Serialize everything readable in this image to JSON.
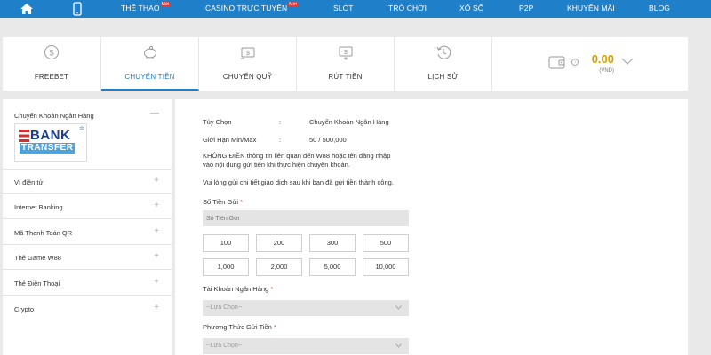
{
  "topnav": {
    "items": [
      {
        "label": "THỂ THAO",
        "hot": "Mới"
      },
      {
        "label": "CASINO TRỰC TUYẾN",
        "hot": "Mới"
      },
      {
        "label": "SLOT"
      },
      {
        "label": "TRÒ CHƠI"
      },
      {
        "label": "XỔ SỐ"
      },
      {
        "label": "P2P"
      },
      {
        "label": "KHUYẾN MÃI"
      },
      {
        "label": "BLOG"
      }
    ]
  },
  "tabs": [
    {
      "label": "FREEBET",
      "icon": "dollar-coin-icon"
    },
    {
      "label": "CHUYỂN TIỀN",
      "icon": "piggy-bank-icon",
      "active": true
    },
    {
      "label": "CHUYỂN QUỸ",
      "icon": "transfer-icon"
    },
    {
      "label": "RÚT TIỀN",
      "icon": "withdraw-icon"
    },
    {
      "label": "LỊCH SỬ",
      "icon": "history-icon"
    }
  ],
  "wallet": {
    "amount": "0.00",
    "currency": "(VND)",
    "info": "i"
  },
  "sidebar": {
    "bank_transfer": {
      "label": "Chuyển Khoản Ngân Hàng",
      "sign": "—",
      "logo_text_1": "BANK",
      "logo_text_2": "TRANSFER"
    },
    "items": [
      {
        "label": "Ví điện tử",
        "sign": "+"
      },
      {
        "label": "Internet Banking",
        "sign": "+"
      },
      {
        "label": "Mã Thanh Toán QR",
        "sign": "+"
      },
      {
        "label": "Thẻ Game W88",
        "sign": "+"
      },
      {
        "label": "Thẻ Điện Thoại",
        "sign": "+"
      },
      {
        "label": "Crypto",
        "sign": "+"
      }
    ]
  },
  "main": {
    "option_label": "Tùy Chọn",
    "option_sep": ":",
    "option_value": "Chuyển Khoản Ngân Hàng",
    "limit_label": "Giới Hạn Min/Max",
    "limit_sep": ":",
    "limit_value": "50 / 500,000",
    "notice_1": "KHÔNG ĐIỀN thông tin liên quan đến W88 hoặc tên đăng nhập",
    "notice_2": "vào nội dung gửi tiền khi thực hiện chuyển khoản.",
    "notice_3": "Vui lòng gửi chi tiết giao dịch sau khi bạn đã gửi tiền thành công.",
    "amount_label": "Số Tiền Gửi",
    "required_mark": "*",
    "amount_placeholder": "Số Tiền Gửi",
    "quick_amounts": [
      "100",
      "200",
      "300",
      "500",
      "1,000",
      "2,000",
      "5,000",
      "10,000"
    ],
    "bank_account_label": "Tài Khoản Ngân Hàng",
    "bank_account_select": "--Lựa Chọn--",
    "method_label": "Phương Thức Gửi Tiền",
    "method_select": "--Lựa Chọn--"
  }
}
